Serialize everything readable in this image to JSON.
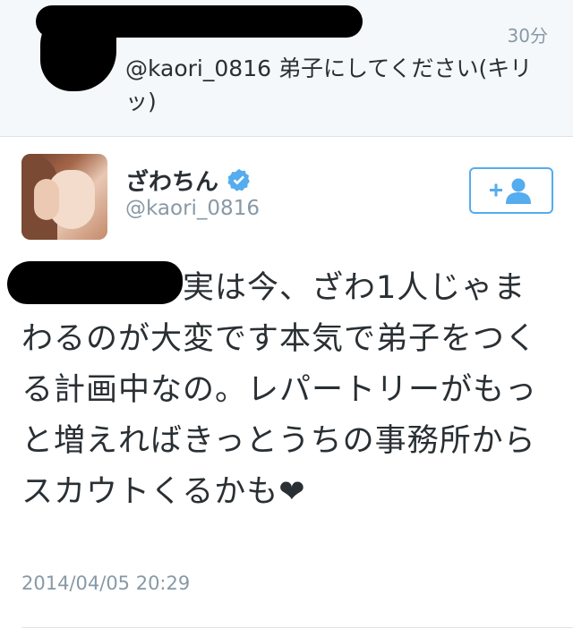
{
  "context_tweet": {
    "time": "30分",
    "text": "@kaori_0816 弟子にしてください(キリッ)"
  },
  "tweet": {
    "display_name": "ざわちん",
    "handle": "@kaori_0816",
    "text": "実は今、ざわ1人じゃまわるのが大変です本気で弟子をつくる計画中なの。レパートリーがもっと増えればきっとうちの事務所からスカウトくるかも❤",
    "timestamp": "2014/04/05 20:29",
    "verified_icon": "verified-badge-icon",
    "follow_icon": "add-user-icon"
  },
  "colors": {
    "accent": "#55acee",
    "text": "#292f33",
    "muted": "#8899a6",
    "context_bg": "#f5f8fa"
  }
}
